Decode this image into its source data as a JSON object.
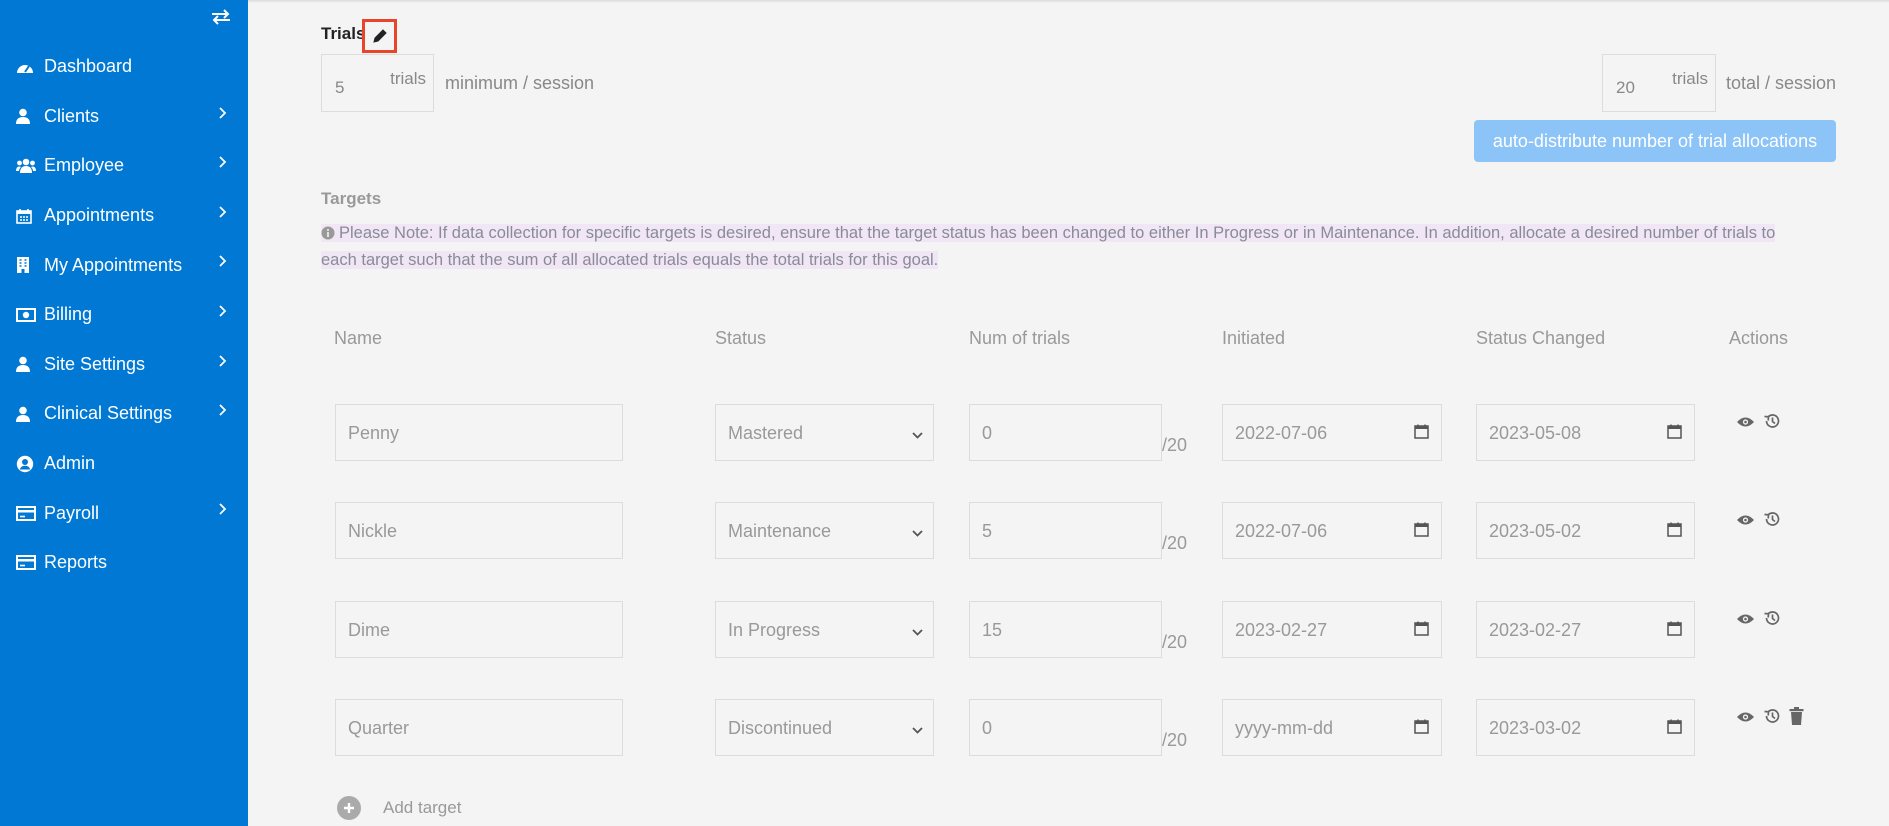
{
  "sidebar": {
    "items": [
      {
        "label": "Dashboard",
        "icon": "dashboard-icon",
        "has_chevron": false
      },
      {
        "label": "Clients",
        "icon": "user-icon",
        "has_chevron": true
      },
      {
        "label": "Employee",
        "icon": "users-icon",
        "has_chevron": true
      },
      {
        "label": "Appointments",
        "icon": "calendar-icon",
        "has_chevron": true
      },
      {
        "label": "My Appointments",
        "icon": "building-icon",
        "has_chevron": true
      },
      {
        "label": "Billing",
        "icon": "money-icon",
        "has_chevron": true
      },
      {
        "label": "Site Settings",
        "icon": "user-icon",
        "has_chevron": true
      },
      {
        "label": "Clinical Settings",
        "icon": "user-icon",
        "has_chevron": true
      },
      {
        "label": "Admin",
        "icon": "user-circle-icon",
        "has_chevron": false
      },
      {
        "label": "Payroll",
        "icon": "credit-card-icon",
        "has_chevron": true
      },
      {
        "label": "Reports",
        "icon": "credit-card-icon",
        "has_chevron": false
      }
    ]
  },
  "trials": {
    "title": "Trials",
    "min_value": "5",
    "min_unit": "trials",
    "min_suffix": "minimum / session",
    "total_value": "20",
    "total_unit": "trials",
    "total_suffix": "total / session",
    "auto_button": "auto-distribute number of trial allocations"
  },
  "targets": {
    "title": "Targets",
    "note": "Please Note: If data collection for specific targets is desired, ensure that the target status has been changed to either In Progress or in Maintenance. In addition, allocate a desired number of trials to each target such that the sum of all allocated trials equals the total trials for this goal.",
    "columns": {
      "name": "Name",
      "status": "Status",
      "num_trials": "Num of trials",
      "initiated": "Initiated",
      "status_changed": "Status Changed",
      "actions": "Actions"
    },
    "rows": [
      {
        "name": "Penny",
        "status": "Mastered",
        "trials": "0",
        "denom": "/20",
        "initiated": "2022-07-06",
        "status_changed": "2023-05-08",
        "deletable": false
      },
      {
        "name": "Nickle",
        "status": "Maintenance",
        "trials": "5",
        "denom": "/20",
        "initiated": "2022-07-06",
        "status_changed": "2023-05-02",
        "deletable": false
      },
      {
        "name": "Dime",
        "status": "In Progress",
        "trials": "15",
        "denom": "/20",
        "initiated": "2023-02-27",
        "status_changed": "2023-02-27",
        "deletable": false
      },
      {
        "name": "Quarter",
        "status": "Discontinued",
        "trials": "0",
        "denom": "/20",
        "initiated": "yyyy-mm-dd",
        "status_changed": "2023-03-02",
        "deletable": true
      }
    ],
    "add_label": "Add target"
  },
  "colors": {
    "sidebar_bg": "#0078d4",
    "accent_button": "#8cc4f7",
    "highlight_border": "#e8452a"
  }
}
